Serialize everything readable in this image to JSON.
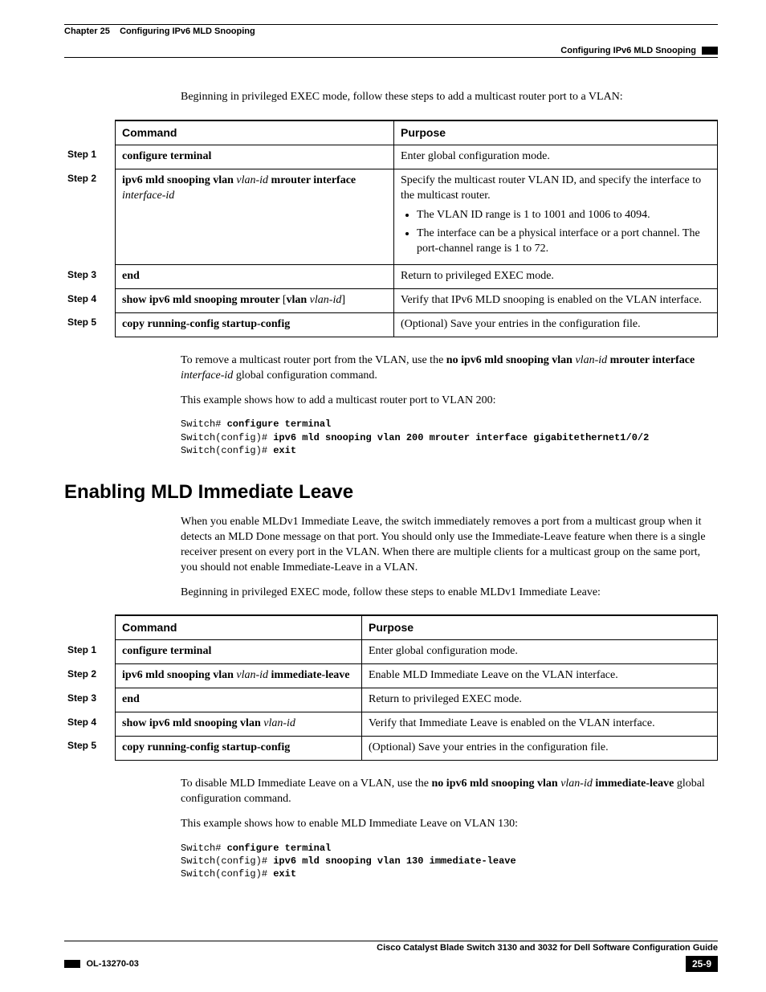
{
  "header": {
    "chapter_label": "Chapter 25",
    "chapter_title": "Configuring IPv6 MLD Snooping",
    "section_title": "Configuring IPv6 MLD Snooping"
  },
  "intro1": "Beginning in privileged EXEC mode, follow these steps to add a multicast router port to a VLAN:",
  "table1": {
    "head_command": "Command",
    "head_purpose": "Purpose",
    "rows": [
      {
        "step": "Step 1",
        "cmd_bold": "configure terminal",
        "purpose": "Enter global configuration mode."
      },
      {
        "step": "Step 2",
        "cmd_b1": "ipv6 mld snooping vlan ",
        "cmd_i1": "vlan-id",
        "cmd_b2": " mrouter interface ",
        "cmd_i2": "interface-id",
        "purpose_lead": "Specify the multicast router VLAN ID, and specify the interface to the multicast router.",
        "bullet1": "The VLAN ID range is 1 to 1001 and 1006 to 4094.",
        "bullet2": "The interface can be a physical interface or a port channel. The port-channel range is 1 to 72."
      },
      {
        "step": "Step 3",
        "cmd_bold": "end",
        "purpose": "Return to privileged EXEC mode."
      },
      {
        "step": "Step 4",
        "cmd_b1": "show ipv6 mld snooping mrouter ",
        "cmd_plain1": "[",
        "cmd_b2": "vlan ",
        "cmd_i1": "vlan-id",
        "cmd_plain2": "]",
        "purpose": "Verify that IPv6 MLD snooping is enabled on the VLAN interface."
      },
      {
        "step": "Step 5",
        "cmd_bold": "copy running-config startup-config",
        "purpose": "(Optional) Save your entries in the configuration file."
      }
    ]
  },
  "after1": {
    "p1_a": "To remove a multicast router port from the VLAN, use the ",
    "p1_b": "no ipv6 mld snooping vlan",
    "p1_c": " vlan-id ",
    "p1_d": "mrouter interface",
    "p1_e": " interface-id",
    "p1_f": " global configuration command.",
    "p2": "This example shows how to add a multicast router port to VLAN 200:"
  },
  "code1": {
    "l1a": "Switch# ",
    "l1b": "configure terminal",
    "l2a": "Switch(config)# ",
    "l2b": "ipv6 mld snooping vlan 200 mrouter interface gigabitethernet1/0/2",
    "l3a": "Switch(config)# ",
    "l3b": "exit"
  },
  "h2": "Enabling MLD Immediate Leave",
  "intro2a": "When you enable MLDv1 Immediate Leave, the switch immediately removes a port from a multicast group when it detects an MLD Done message on that port. You should only use the Immediate-Leave feature when there is a single receiver present on every port in the VLAN. When there are multiple clients for a multicast group on the same port, you should not enable Immediate-Leave in a VLAN.",
  "intro2b": "Beginning in privileged EXEC mode, follow these steps to enable MLDv1 Immediate Leave:",
  "table2": {
    "head_command": "Command",
    "head_purpose": "Purpose",
    "rows": [
      {
        "step": "Step 1",
        "cmd_bold": "configure terminal",
        "purpose": "Enter global configuration mode."
      },
      {
        "step": "Step 2",
        "cmd_b1": "ipv6 mld snooping vlan ",
        "cmd_i1": "vlan-id",
        "cmd_b2": " immediate-leave",
        "purpose": "Enable MLD Immediate Leave on the VLAN interface."
      },
      {
        "step": "Step 3",
        "cmd_bold": "end",
        "purpose": "Return to privileged EXEC mode."
      },
      {
        "step": "Step 4",
        "cmd_b1": "show ipv6 mld snooping vlan ",
        "cmd_i1": "vlan-id",
        "purpose": "Verify that Immediate Leave is enabled on the VLAN interface."
      },
      {
        "step": "Step 5",
        "cmd_bold": "copy running-config startup-config",
        "purpose": "(Optional) Save your entries in the configuration file."
      }
    ]
  },
  "after2": {
    "p1_a": "To disable MLD Immediate Leave on a VLAN, use the ",
    "p1_b": "no ipv6 mld snooping vlan",
    "p1_c": " vlan-id ",
    "p1_d": "immediate-leave",
    "p1_e": " global configuration command.",
    "p2": "This example shows how to enable MLD Immediate Leave on VLAN 130:"
  },
  "code2": {
    "l1a": "Switch# ",
    "l1b": "configure terminal",
    "l2a": "Switch(config)# ",
    "l2b": "ipv6 mld snooping vlan 130 immediate-leave",
    "l3a": "Switch(config)# ",
    "l3b": "exit"
  },
  "footer": {
    "guide": "Cisco Catalyst Blade Switch 3130 and 3032 for Dell Software Configuration Guide",
    "docnum": "OL-13270-03",
    "pagenum": "25-9"
  }
}
